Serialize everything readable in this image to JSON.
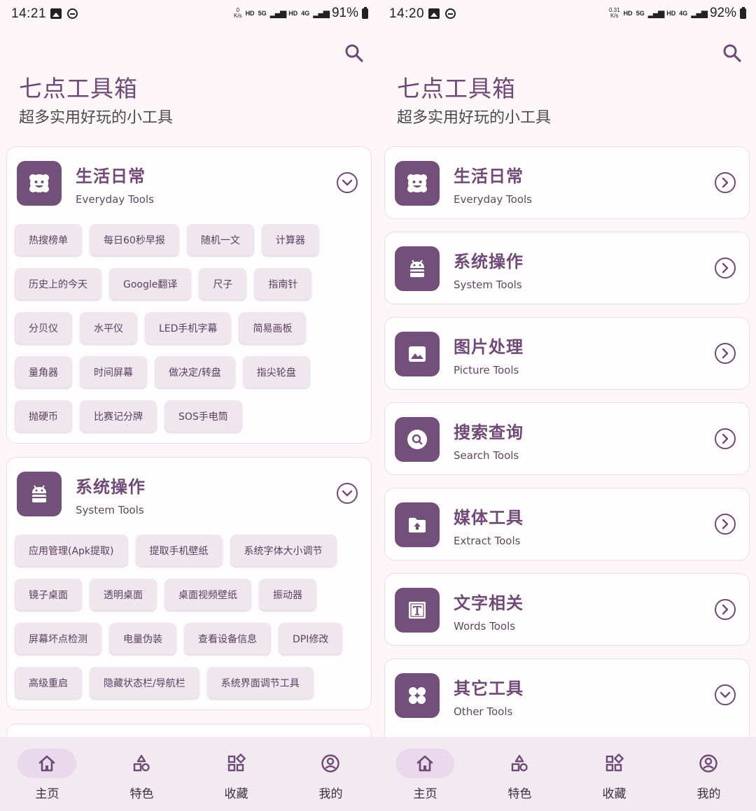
{
  "left": {
    "status": {
      "time": "14:21",
      "speed_top": "0",
      "speed_unit": "K/s",
      "hd1": "HD",
      "net1": "5G",
      "hd2": "HD",
      "net2": "4G",
      "battery": "91%"
    },
    "app_title": "七点工具箱",
    "app_subtitle": "超多实用好玩的小工具",
    "cat1": {
      "title": "生活日常",
      "subtitle": "Everyday Tools",
      "rows": [
        [
          "热搜榜单",
          "每日60秒早报",
          "随机一文",
          "计算器"
        ],
        [
          "历史上的今天",
          "Google翻译",
          "尺子",
          "指南针"
        ],
        [
          "分贝仪",
          "水平仪",
          "LED手机字幕",
          "简易画板"
        ],
        [
          "量角器",
          "时间屏幕",
          "做决定/转盘",
          "指尖轮盘"
        ],
        [
          "抛硬币",
          "比赛记分牌",
          "SOS手电筒"
        ]
      ]
    },
    "cat2": {
      "title": "系统操作",
      "subtitle": "System Tools",
      "rows": [
        [
          "应用管理(Apk提取)",
          "提取手机壁纸",
          "系统字体大小调节"
        ],
        [
          "镜子桌面",
          "透明桌面",
          "桌面视频壁纸",
          "振动器"
        ],
        [
          "屏幕坏点检测",
          "电量伪装",
          "查看设备信息",
          "DPI修改"
        ],
        [
          "高级重启",
          "隐藏状态栏/导航栏",
          "系统界面调节工具"
        ]
      ]
    }
  },
  "right": {
    "status": {
      "time": "14:20",
      "speed_top": "0.31",
      "speed_unit": "K/s",
      "hd1": "HD",
      "net1": "5G",
      "hd2": "HD",
      "net2": "4G",
      "battery": "92%"
    },
    "app_title": "七点工具箱",
    "app_subtitle": "超多实用好玩的小工具",
    "cats": [
      {
        "title": "生活日常",
        "subtitle": "Everyday Tools",
        "icon": "flower-face-icon"
      },
      {
        "title": "系统操作",
        "subtitle": "System Tools",
        "icon": "android-icon"
      },
      {
        "title": "图片处理",
        "subtitle": "Picture Tools",
        "icon": "image-icon"
      },
      {
        "title": "搜索查询",
        "subtitle": "Search Tools",
        "icon": "search-icon"
      },
      {
        "title": "媒体工具",
        "subtitle": "Extract Tools",
        "icon": "folder-upload-icon"
      },
      {
        "title": "文字相关",
        "subtitle": "Words Tools",
        "icon": "text-icon"
      },
      {
        "title": "其它工具",
        "subtitle": "Other Tools",
        "icon": "grid-icon"
      }
    ]
  },
  "nav": [
    {
      "label": "主页",
      "icon": "home-icon"
    },
    {
      "label": "特色",
      "icon": "shapes-icon"
    },
    {
      "label": "收藏",
      "icon": "widgets-icon"
    },
    {
      "label": "我的",
      "icon": "account-icon"
    }
  ],
  "colors": {
    "accent": "#73507a",
    "background": "#fdf7fa",
    "chip": "#efe6ee",
    "nav_active": "#ead8ec"
  }
}
